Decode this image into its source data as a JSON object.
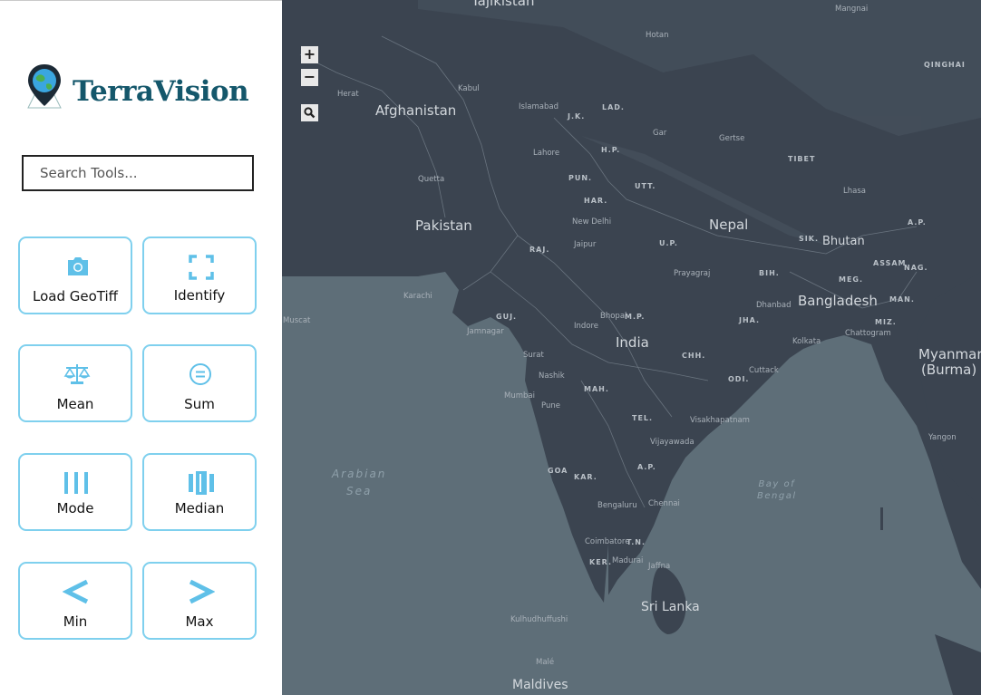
{
  "app": {
    "brand": "TerraVision"
  },
  "search": {
    "placeholder": "Search Tools..."
  },
  "tools": [
    {
      "label": "Load GeoTiff",
      "icon": "camera-icon"
    },
    {
      "label": "Identify",
      "icon": "focus-frame-icon"
    },
    {
      "label": "Mean",
      "icon": "balance-scale-icon"
    },
    {
      "label": "Sum",
      "icon": "equals-circle-icon"
    },
    {
      "label": "Mode",
      "icon": "bars-icon"
    },
    {
      "label": "Median",
      "icon": "median-bars-icon"
    },
    {
      "label": "Min",
      "icon": "less-than-icon"
    },
    {
      "label": "Max",
      "icon": "greater-than-icon"
    }
  ],
  "colors": {
    "brand": "#14576b",
    "accent": "#7fd0ee",
    "icon": "#5fc0e8",
    "land": "#3a4350",
    "sea": "#5e6e78"
  },
  "map": {
    "controls": {
      "zoom_in": "+",
      "zoom_out": "−",
      "search_icon": "magnifier-icon"
    },
    "countries": [
      "Tajikistan",
      "Afghanistan",
      "Pakistan",
      "Nepal",
      "Bhutan",
      "Bangladesh",
      "India",
      "Myanmar",
      "(Burma)",
      "Sri Lanka",
      "Maldives"
    ],
    "states": [
      "J.K.",
      "LAD.",
      "H.P.",
      "PUN.",
      "HAR.",
      "UTT.",
      "RAJ.",
      "U.P.",
      "BIH.",
      "SIK.",
      "ASSAM",
      "NAG.",
      "MEG.",
      "MAN.",
      "MIZ.",
      "JHA.",
      "M.P.",
      "GUJ.",
      "CHH.",
      "ODI.",
      "MAH.",
      "TEL.",
      "A.P.",
      "KAR.",
      "GOA",
      "T.N.",
      "KER.",
      "A.P.",
      "TIBET",
      "QINGHAI"
    ],
    "cities": [
      "Herat",
      "Kabul",
      "Islamabad",
      "Lahore",
      "Quetta",
      "Karachi",
      "New Delhi",
      "Jaipur",
      "Prayagraj",
      "Bhopal",
      "Indore",
      "Jamnagar",
      "Surat",
      "Nashik",
      "Mumbai",
      "Pune",
      "Visakhapatnam",
      "Vijayawada",
      "Chennai",
      "Bengaluru",
      "Coimbatore",
      "Madurai",
      "Jaffna",
      "Kulhudhuffushi",
      "Malé",
      "Dhanbad",
      "Kolkata",
      "Cuttack",
      "Chattogram",
      "Yangon",
      "Lhasa",
      "Gertse",
      "Gar",
      "Hotan",
      "Mangnai",
      "Muscat"
    ],
    "seas": {
      "arabian": "Arabian\nSea",
      "bengal": "Bay of\nBengal"
    }
  }
}
